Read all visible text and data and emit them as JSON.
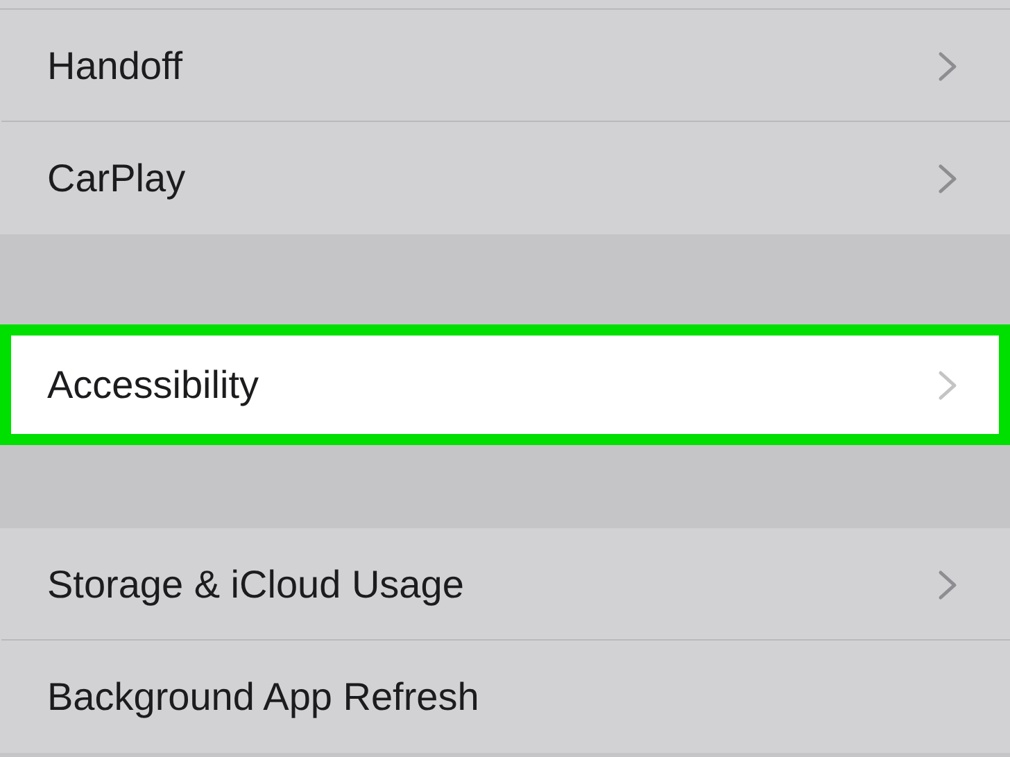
{
  "sections": [
    {
      "rows": [
        {
          "label": "Handoff",
          "highlighted": false,
          "chevron": true
        },
        {
          "label": "CarPlay",
          "highlighted": false,
          "chevron": true
        }
      ]
    },
    {
      "rows": [
        {
          "label": "Accessibility",
          "highlighted": true,
          "chevron": true
        }
      ]
    },
    {
      "rows": [
        {
          "label": "Storage & iCloud Usage",
          "highlighted": false,
          "chevron": true
        },
        {
          "label": "Background App Refresh",
          "highlighted": false,
          "chevron": false
        }
      ]
    }
  ]
}
